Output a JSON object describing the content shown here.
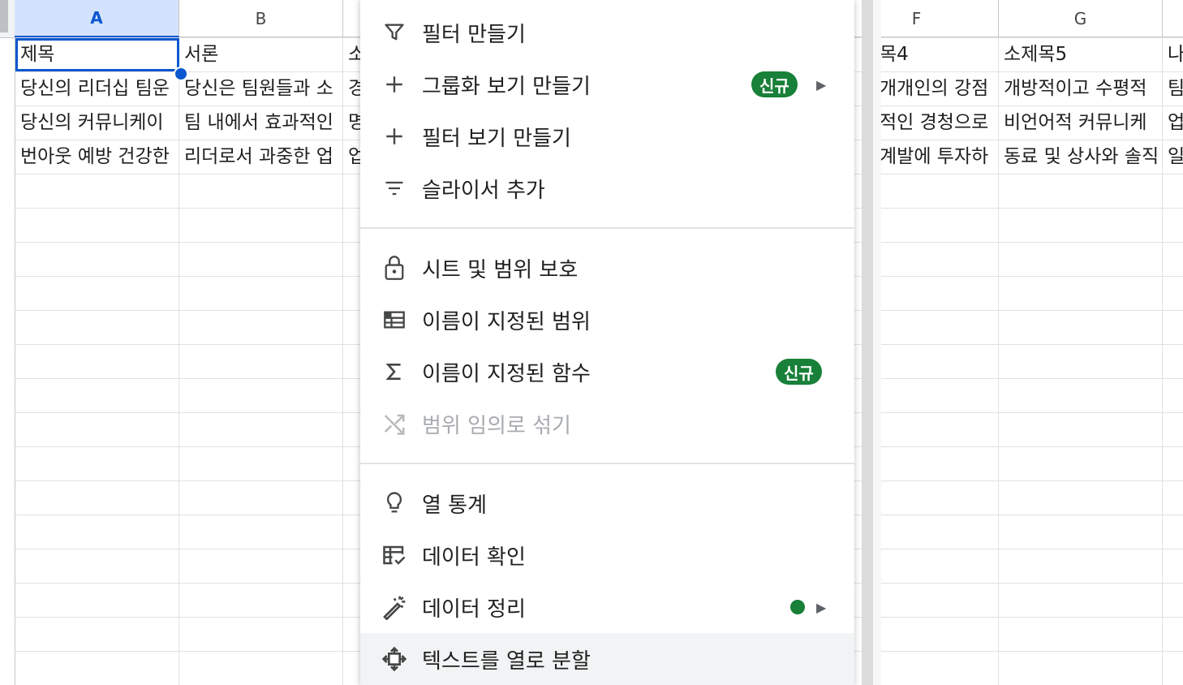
{
  "columns": {
    "A": "A",
    "B": "B",
    "F": "F",
    "G": "G"
  },
  "rows": {
    "r1": {
      "A": "제목",
      "B": "서론",
      "C": "소",
      "F": "목4",
      "G": "소제목5",
      "H": "나"
    },
    "r2": {
      "A": "당신의 리더십 팀운",
      "B": "당신은 팀원들과 소",
      "C": "경",
      "F": "개개인의 강점",
      "G": "개방적이고 수평적",
      "H": "팀"
    },
    "r3": {
      "A": "당신의 커뮤니케이",
      "B": "팀 내에서 효과적인",
      "C": "명",
      "F": "적인 경청으로",
      "G": "비언어적 커뮤니케",
      "H": "업"
    },
    "r4": {
      "A": "번아웃 예방 건강한",
      "B": "리더로서 과중한 업",
      "C": "업",
      "F": "계발에 투자하",
      "G": "동료 및 상사와 솔직",
      "H": "일"
    }
  },
  "menu": {
    "create_filter": "필터 만들기",
    "create_group_view": "그룹화 보기 만들기",
    "create_filter_view": "필터 보기 만들기",
    "add_slicer": "슬라이서 추가",
    "protect_sheets_ranges": "시트 및 범위 보호",
    "named_ranges": "이름이 지정된 범위",
    "named_functions": "이름이 지정된 함수",
    "randomize_range": "범위 임의로 섞기",
    "column_stats": "열 통계",
    "data_validation": "데이터 확인",
    "data_cleanup": "데이터 정리",
    "split_text_to_columns": "텍스트를 열로 분할",
    "new_badge": "신규"
  },
  "icons": {
    "create_filter": "filter-icon",
    "create_group_view": "plus-icon",
    "create_filter_view": "plus-icon",
    "add_slicer": "slicer-icon",
    "protect_sheets_ranges": "lock-icon",
    "named_ranges": "named-range-icon",
    "named_functions": "sigma-icon",
    "randomize_range": "shuffle-icon",
    "column_stats": "lightbulb-icon",
    "data_validation": "data-validation-icon",
    "data_cleanup": "magic-wand-icon",
    "split_text_to_columns": "split-columns-icon"
  },
  "colors": {
    "accent": "#0b57d0",
    "badge": "#188038",
    "selected_header": "#d3e3fd"
  }
}
